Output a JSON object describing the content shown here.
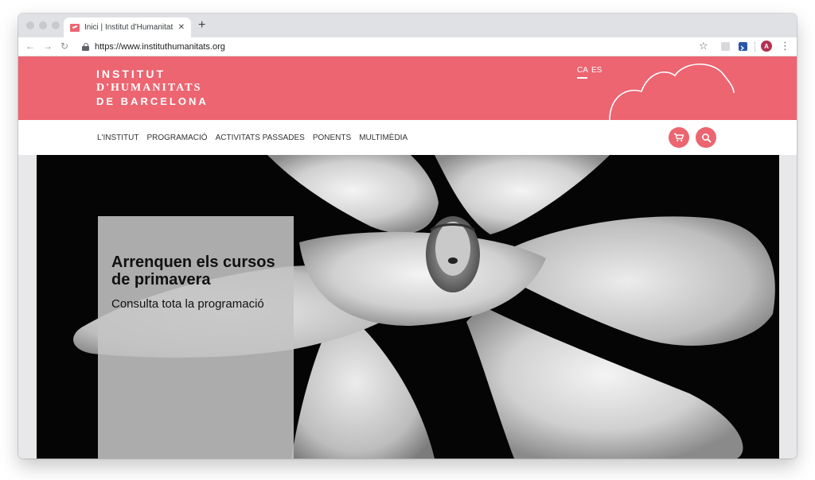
{
  "browser": {
    "tab_title": "Inici | Institut d'Humanitats de Barcelona",
    "tab_close": "✕",
    "new_tab": "+",
    "url": "https://www.instituthumanitats.org",
    "avatar_letter": "A",
    "icons": {
      "back": "arrow-left-icon",
      "forward": "arrow-right-icon",
      "reload": "reload-icon",
      "lock": "lock-icon",
      "bookmark": "star-icon",
      "menu": "more-vert-icon"
    }
  },
  "site": {
    "brand_color": "#ec6571",
    "logo": {
      "line1": "INSTITUT",
      "line2": "D'HUMANITATS",
      "line3": "DE BARCELONA"
    },
    "languages": [
      {
        "code": "CA",
        "active": true
      },
      {
        "code": "ES",
        "active": false
      }
    ],
    "nav": [
      {
        "label": "L'INSTITUT"
      },
      {
        "label": "PROGRAMACIÓ"
      },
      {
        "label": "ACTIVITATS PASSADES"
      },
      {
        "label": "PONENTS"
      },
      {
        "label": "MULTIMÈDIA"
      }
    ],
    "actions": {
      "cart_icon": "cart-icon",
      "search_icon": "search-icon"
    }
  },
  "hero": {
    "title": "Arrenquen els cursos de primavera",
    "subtitle": "Consulta tota la programació"
  }
}
